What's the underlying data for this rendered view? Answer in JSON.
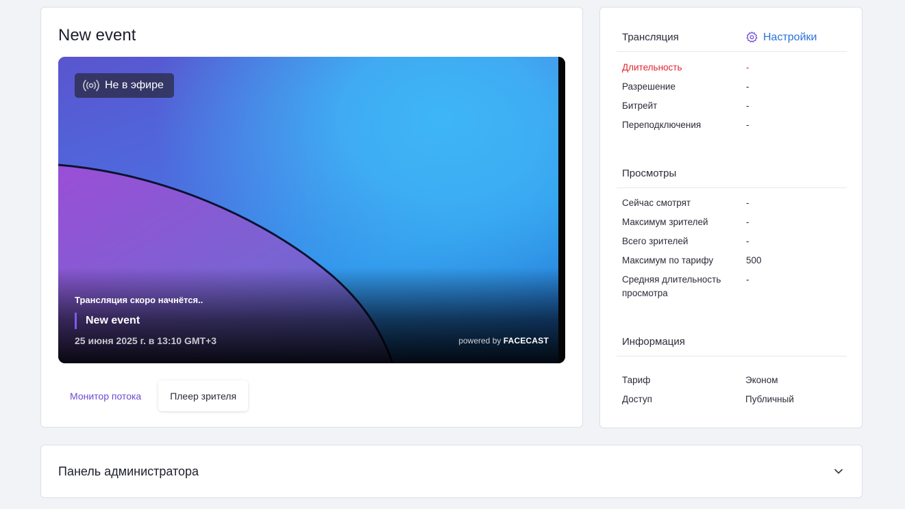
{
  "event": {
    "title": "New event",
    "player": {
      "status": "Не в эфире",
      "soon_text": "Трансляция скоро начнётся..",
      "title": "New event",
      "date": "25 июня 2025 г. в 13:10 GMT+3",
      "powered_prefix": "powered by",
      "powered_brand": "FACECAST"
    },
    "tabs": [
      {
        "label": "Монитор потока",
        "active": false
      },
      {
        "label": "Плеер зрителя",
        "active": true
      }
    ]
  },
  "stats": {
    "broadcast": {
      "title": "Трансляция",
      "settings_label": "Настройки",
      "rows": [
        {
          "label": "Длительность",
          "value": "-"
        },
        {
          "label": "Разрешение",
          "value": "-"
        },
        {
          "label": "Битрейт",
          "value": "-"
        },
        {
          "label": "Переподключения",
          "value": "-"
        }
      ]
    },
    "views": {
      "title": "Просмотры",
      "rows": [
        {
          "label": "Сейчас смотрят",
          "value": "-"
        },
        {
          "label": "Максимум зрителей",
          "value": "-"
        },
        {
          "label": "Всего зрителей",
          "value": "-"
        },
        {
          "label": "Максимум по тарифу",
          "value": "500"
        },
        {
          "label": "Средняя длительность просмотра",
          "value": "-"
        }
      ]
    },
    "info": {
      "title": "Информация",
      "rows": [
        {
          "label": "Тариф",
          "value": "Эконом"
        },
        {
          "label": "Доступ",
          "value": "Публичный"
        }
      ]
    }
  },
  "admin": {
    "title": "Панель администратора"
  },
  "colors": {
    "accent": "#6a4bd0",
    "link": "#2a73d8",
    "alert": "#e0242f",
    "background": "#f2f3f7"
  }
}
